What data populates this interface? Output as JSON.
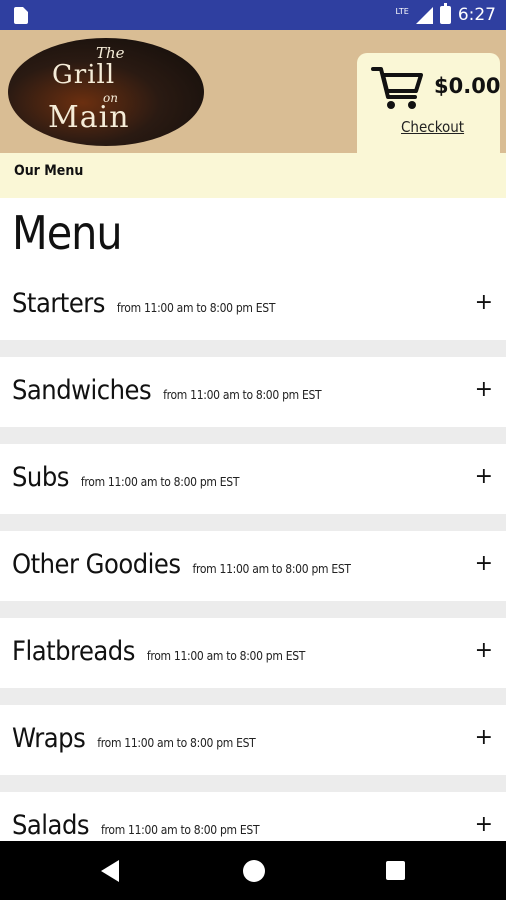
{
  "status_bar": {
    "network": "LTE",
    "time": "6:27"
  },
  "header": {
    "logo": {
      "the": "The",
      "grill": "Grill",
      "on": "on",
      "main": "Main"
    },
    "cart": {
      "total": "$0.00",
      "checkout_label": "Checkout",
      "icon": "shopping-cart-icon"
    }
  },
  "breadcrumb": {
    "label": "Our Menu"
  },
  "menu": {
    "title": "Menu",
    "sections": [
      {
        "name": "Starters",
        "hours": "from 11:00 am to 8:00 pm EST"
      },
      {
        "name": "Sandwiches",
        "hours": "from 11:00 am to 8:00 pm EST"
      },
      {
        "name": "Subs",
        "hours": "from 11:00 am to 8:00 pm EST"
      },
      {
        "name": "Other Goodies",
        "hours": "from 11:00 am to 8:00 pm EST"
      },
      {
        "name": "Flatbreads",
        "hours": "from 11:00 am to 8:00 pm EST"
      },
      {
        "name": "Wraps",
        "hours": "from 11:00 am to 8:00 pm EST"
      },
      {
        "name": "Salads",
        "hours": "from 11:00 am to 8:00 pm EST"
      }
    ],
    "expand_symbol": "+"
  },
  "colors": {
    "status_bar": "#2f3fa0",
    "header_bg": "#d9bd94",
    "accent_bg": "#faf7d6",
    "separator": "#ececec"
  }
}
